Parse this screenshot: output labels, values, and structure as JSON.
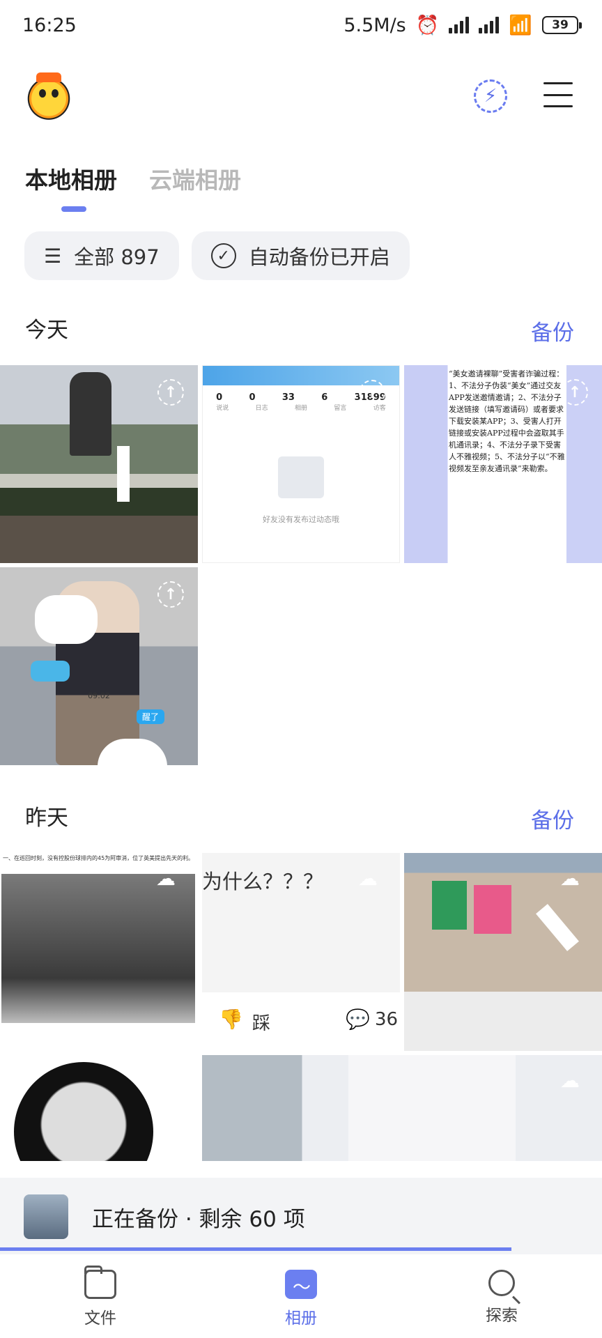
{
  "status_bar": {
    "time": "16:25",
    "speed": "5.5M/s",
    "battery": "39"
  },
  "header": {
    "avatar_icon": "avatar-cartoon",
    "flash_icon": "flash-icon",
    "menu_icon": "menu-icon"
  },
  "tabs": [
    {
      "label": "本地相册",
      "active": true
    },
    {
      "label": "云端相册",
      "active": false
    }
  ],
  "chips": {
    "all_label": "全部 897",
    "auto_backup_label": "自动备份已开启"
  },
  "sections": [
    {
      "title": "今天",
      "action": "备份"
    },
    {
      "title": "昨天",
      "action": "备份"
    }
  ],
  "thumb_texts": {
    "profile_stats": [
      "0",
      "0",
      "33",
      "6",
      "31899"
    ],
    "profile_stat_labels": [
      "说说",
      "日志",
      "相册",
      "留言",
      "访客"
    ],
    "profile_empty": "好友没有发布过动态哦",
    "fraud_text": "“美女邀请裸聊”受害者诈骗过程：1、不法分子伪装“美女”通过交友APP发送邀情邀请；2、不法分子发送链接（填写邀请码）或者要求下载安装某APP；3、受害人打开链接或安装APP过程中会盗取其手机通讯录；4、不法分子录下受害人不雅视频；5、不法分子以“不雅视频发至亲友通讯录”来勒索。",
    "video_time": "09:02",
    "chat_bubble": "醒了",
    "news_caption": "一、在巡回时刻，没有控股份球排内的45为阿审消，位了英美提出先天的利。",
    "question_text": "为什么？？？",
    "dislike_label": "踩",
    "comment_count": "36"
  },
  "backup_status": {
    "text": "正在备份 · 剩余 60 项",
    "progress": 0.85
  },
  "nav": [
    {
      "label": "文件",
      "icon": "folder-icon",
      "active": false
    },
    {
      "label": "相册",
      "icon": "album-icon",
      "active": true
    },
    {
      "label": "探索",
      "icon": "search-icon",
      "active": false
    }
  ],
  "colors": {
    "accent": "#6b7ff0",
    "link": "#5b6ee8"
  }
}
